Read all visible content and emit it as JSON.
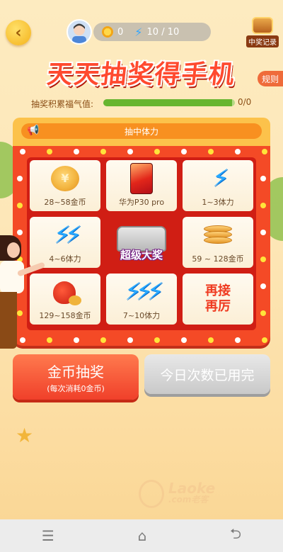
{
  "header": {
    "coins": "0",
    "energy": "10 / 10",
    "record_label": "中奖记录"
  },
  "title": "天天抽奖得手机",
  "rules_label": "规则",
  "progress": {
    "label": "抽奖积累福气值:",
    "value": "0/0",
    "fraction": 0.98
  },
  "banner": "抽中体力",
  "prizes": [
    {
      "label": "28~58金币",
      "icon": "gold-coin-icon"
    },
    {
      "label": "华为P30 pro",
      "icon": "phone-icon"
    },
    {
      "label": "1~3体力",
      "icon": "energy-bolt-icon"
    },
    {
      "label": "4~6体力",
      "icon": "double-bolt-icon"
    },
    {
      "label": "59 ~ 128金币",
      "icon": "coin-stack-icon"
    },
    {
      "label": "129~158金币",
      "icon": "red-bag-icon"
    },
    {
      "label": "7~10体力",
      "icon": "triple-bolt-icon"
    },
    {
      "label": "再接\n再厉",
      "icon": ""
    }
  ],
  "center": {
    "label": "超级大奖",
    "icon": "treasure-chest-icon"
  },
  "buttons": {
    "draw_main": "金币抽奖",
    "draw_sub": "(每次消耗0金币)",
    "used_up": "今日次数已用完"
  },
  "watermark": {
    "line1": "Laoke",
    "line2": ".com老客"
  },
  "colors": {
    "primary": "#f0402a",
    "frame": "#f44a26",
    "progress_fill": "#67b52f",
    "energy": "#28a9ff"
  }
}
